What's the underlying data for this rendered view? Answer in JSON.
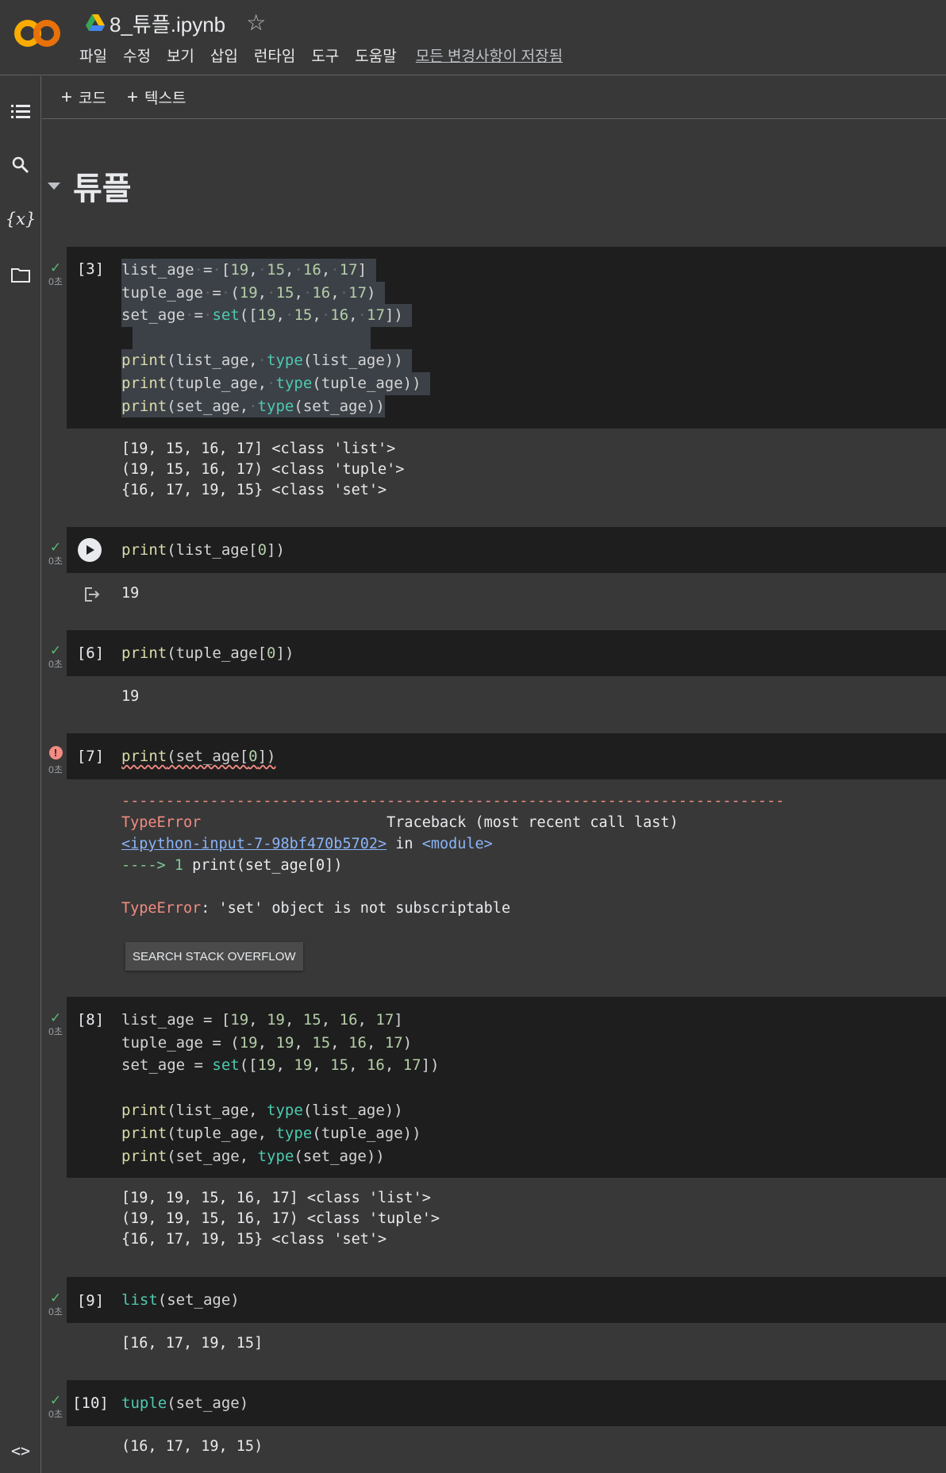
{
  "header": {
    "title": "8_튜플.ipynb",
    "menu": [
      "파일",
      "수정",
      "보기",
      "삽입",
      "런타임",
      "도구",
      "도움말"
    ],
    "saved_status": "모든 변경사항이 저장됨"
  },
  "toolbar": {
    "add_code": "코드",
    "add_text": "텍스트"
  },
  "section": {
    "title": "튜플"
  },
  "cells": {
    "c3": {
      "exec": "[3]",
      "elapsed": "0초",
      "code": [
        "list_age = [19, 15, 16, 17]",
        "tuple_age = (19, 15, 16, 17)",
        "set_age = set([19, 15, 16, 17])",
        "",
        "print(list_age, type(list_age))",
        "print(tuple_age, type(tuple_age))",
        "print(set_age, type(set_age))"
      ],
      "output": [
        "[19, 15, 16, 17] <class 'list'>",
        "(19, 15, 16, 17) <class 'tuple'>",
        "{16, 17, 19, 15} <class 'set'>"
      ]
    },
    "c_run": {
      "elapsed": "0초",
      "code": [
        "print(list_age[0])"
      ],
      "output": [
        "19"
      ]
    },
    "c6": {
      "exec": "[6]",
      "elapsed": "0초",
      "code": [
        "print(tuple_age[0])"
      ],
      "output": [
        "19"
      ]
    },
    "c7": {
      "exec": "[7]",
      "elapsed": "0초",
      "code": [
        "print(set_age[0])"
      ],
      "error": {
        "dashes": "---------------------------------------------------------------------------",
        "type": "TypeError",
        "traceback_label": "Traceback (most recent call last)",
        "link": "<ipython-input-7-98bf470b5702>",
        "in_text": " in ",
        "module": "<module>",
        "arrow": "----> 1",
        "arrow_code": " print(set_age[0])",
        "message_type": "TypeError",
        "message": ": 'set' object is not subscriptable"
      },
      "so_button": "SEARCH STACK OVERFLOW"
    },
    "c8": {
      "exec": "[8]",
      "elapsed": "0초",
      "code": [
        "list_age = [19, 19, 15, 16, 17]",
        "tuple_age = (19, 19, 15, 16, 17)",
        "set_age = set([19, 19, 15, 16, 17])",
        "",
        "print(list_age, type(list_age))",
        "print(tuple_age, type(tuple_age))",
        "print(set_age, type(set_age))"
      ],
      "output": [
        "[19, 19, 15, 16, 17] <class 'list'>",
        "(19, 19, 15, 16, 17) <class 'tuple'>",
        "{16, 17, 19, 15} <class 'set'>"
      ]
    },
    "c9": {
      "exec": "[9]",
      "elapsed": "0초",
      "code": [
        "list(set_age)"
      ],
      "output": [
        "[16, 17, 19, 15]"
      ]
    },
    "c10": {
      "exec": "[10]",
      "elapsed": "0초",
      "code": [
        "tuple(set_age)"
      ],
      "output": [
        "(16, 17, 19, 15)"
      ]
    }
  },
  "icons": {
    "logo": "colab-logo",
    "drive": "drive-icon",
    "star": "star-icon",
    "toc": "toc-icon",
    "search": "search-icon",
    "variables": "variables-icon",
    "files": "folder-icon",
    "code_snippets": "code-icon"
  },
  "colors": {
    "accent_orange": "#f9ab00",
    "success": "#5bb974",
    "error": "#f28b82",
    "link": "#8ab4f8"
  }
}
